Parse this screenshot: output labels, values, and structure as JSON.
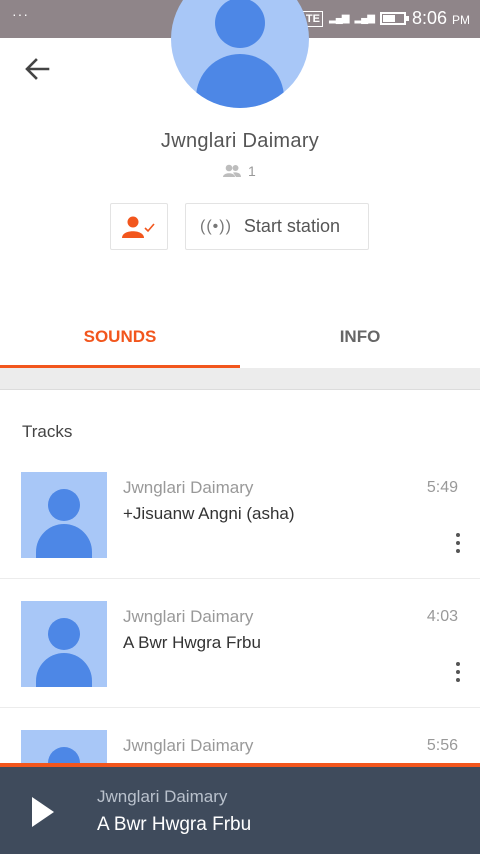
{
  "status_bar": {
    "dots": "···",
    "volte": "VOLTE",
    "network1": "4G 4G",
    "clock": "8:06",
    "ampm": "PM"
  },
  "profile": {
    "name": "Jwnglari Daimary",
    "followers_count": "1"
  },
  "actions": {
    "start_station_label": "Start station"
  },
  "tabs": [
    {
      "label": "SOUNDS",
      "active": true
    },
    {
      "label": "INFO",
      "active": false
    }
  ],
  "tracks_section": {
    "title": "Tracks",
    "items": [
      {
        "artist": "Jwnglari Daimary",
        "title": "+Jisuanw Angni (asha)",
        "duration": "5:49"
      },
      {
        "artist": "Jwnglari Daimary",
        "title": "A Bwr Hwgra Frbu",
        "duration": "4:03"
      },
      {
        "artist": "Jwnglari Daimary",
        "title": "",
        "duration": "5:56"
      }
    ]
  },
  "player": {
    "artist": "Jwnglari Daimary",
    "title": "A Bwr Hwgra Frbu"
  },
  "colors": {
    "accent": "#f2561d",
    "avatar_bg": "#a8c7f7",
    "avatar_fg": "#4d87e6",
    "player_bg": "#3f4b5c"
  }
}
